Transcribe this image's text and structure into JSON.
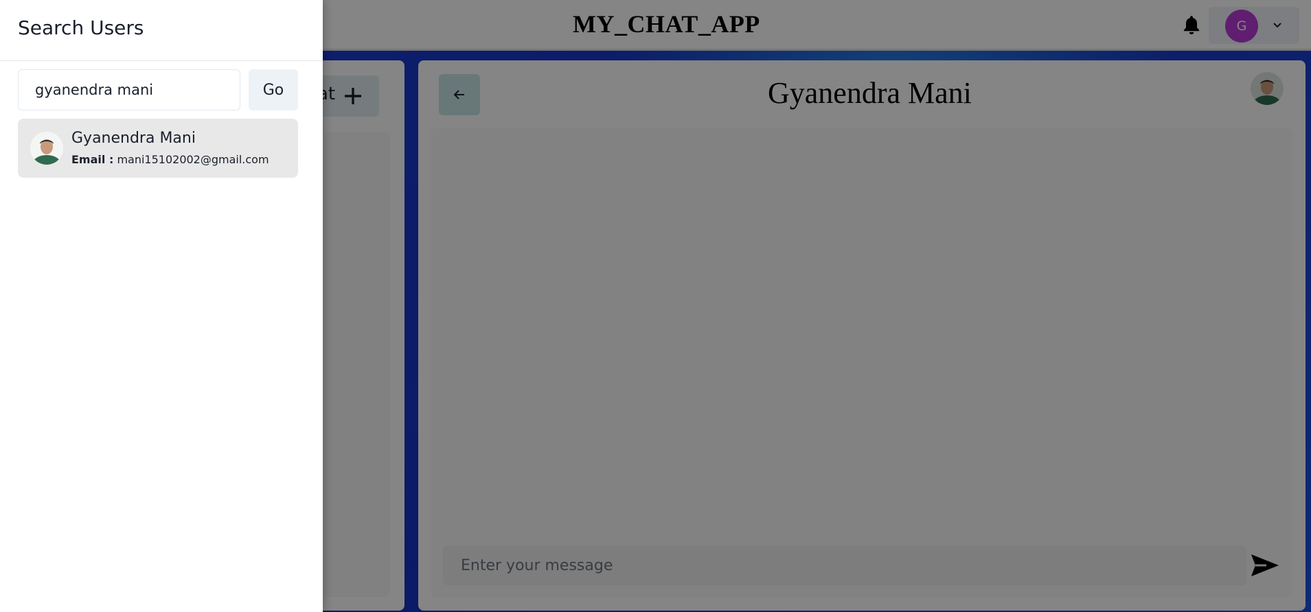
{
  "app": {
    "title": "MY_CHAT_APP",
    "profile_initial": "G",
    "new_chat_label": "at"
  },
  "chat": {
    "recipient_name": "Gyanendra Mani",
    "message_placeholder": "Enter your message"
  },
  "drawer": {
    "title": "Search Users",
    "search_value": "gyanendra mani",
    "go_label": "Go",
    "results": [
      {
        "name": "Gyanendra Mani",
        "email_label": "Email :",
        "email": "mani15102002@gmail.com"
      }
    ]
  },
  "icons": {
    "bell": "bell-icon",
    "chevron": "chevron-down-icon",
    "plus": "plus-icon",
    "back": "arrow-left-icon",
    "send": "send-icon"
  },
  "colors": {
    "avatar_bg": "#b83ad6",
    "background_blue": "#1a3fd0",
    "back_button": "#c7e6e8"
  }
}
